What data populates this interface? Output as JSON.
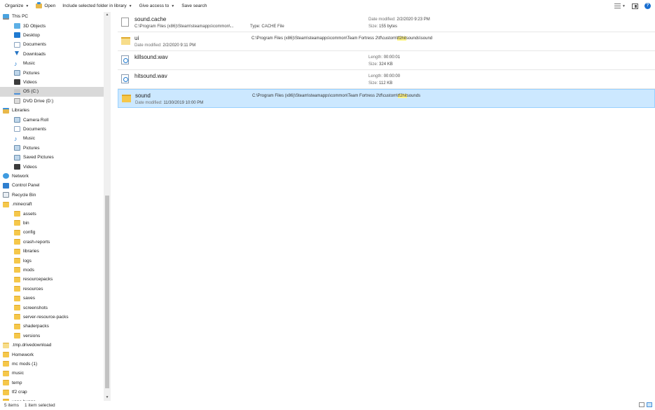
{
  "toolbar": {
    "organize": "Organize",
    "open": "Open",
    "include_library": "Include selected folder in library",
    "give_access": "Give access to",
    "save_search": "Save search"
  },
  "nav": {
    "items": [
      {
        "label": "This PC",
        "icon": "pc",
        "indent": 4
      },
      {
        "label": "3D Objects",
        "icon": "cube",
        "indent": 20
      },
      {
        "label": "Desktop",
        "icon": "desk",
        "indent": 20
      },
      {
        "label": "Documents",
        "icon": "doc",
        "indent": 20
      },
      {
        "label": "Downloads",
        "icon": "down",
        "indent": 20
      },
      {
        "label": "Music",
        "icon": "music",
        "indent": 20
      },
      {
        "label": "Pictures",
        "icon": "pic",
        "indent": 20
      },
      {
        "label": "Videos",
        "icon": "vid",
        "indent": 20
      },
      {
        "label": "OS (C:)",
        "icon": "drive",
        "indent": 20,
        "selected": true
      },
      {
        "label": "DVD Drive (D:)",
        "icon": "dvd",
        "indent": 20
      },
      {
        "label": "Libraries",
        "icon": "lib",
        "indent": 4
      },
      {
        "label": "Camera Roll",
        "icon": "pic",
        "indent": 20
      },
      {
        "label": "Documents",
        "icon": "doc",
        "indent": 20
      },
      {
        "label": "Music",
        "icon": "music",
        "indent": 20
      },
      {
        "label": "Pictures",
        "icon": "pic",
        "indent": 20
      },
      {
        "label": "Saved Pictures",
        "icon": "pic",
        "indent": 20
      },
      {
        "label": "Videos",
        "icon": "vid",
        "indent": 20
      },
      {
        "label": "Network",
        "icon": "net",
        "indent": 4
      },
      {
        "label": "Control Panel",
        "icon": "cp",
        "indent": 4
      },
      {
        "label": "Recycle Bin",
        "icon": "bin",
        "indent": 4
      },
      {
        "label": ".minecraft",
        "icon": "folder",
        "indent": 4
      },
      {
        "label": "assets",
        "icon": "folder",
        "indent": 20
      },
      {
        "label": "bin",
        "icon": "folder",
        "indent": 20
      },
      {
        "label": "config",
        "icon": "folder",
        "indent": 20
      },
      {
        "label": "crash-reports",
        "icon": "folder",
        "indent": 20
      },
      {
        "label": "libraries",
        "icon": "folder",
        "indent": 20
      },
      {
        "label": "logs",
        "icon": "folder",
        "indent": 20
      },
      {
        "label": "mods",
        "icon": "folder",
        "indent": 20
      },
      {
        "label": "resourcepacks",
        "icon": "folder",
        "indent": 20
      },
      {
        "label": "resources",
        "icon": "folder",
        "indent": 20
      },
      {
        "label": "saves",
        "icon": "folder",
        "indent": 20
      },
      {
        "label": "screenshots",
        "icon": "folder",
        "indent": 20
      },
      {
        "label": "server-resource-packs",
        "icon": "folder",
        "indent": 20
      },
      {
        "label": "shaderpacks",
        "icon": "folder",
        "indent": 20
      },
      {
        "label": "versions",
        "icon": "folder",
        "indent": 20
      },
      {
        "label": ".tmp.drivedownload",
        "icon": "folder light",
        "indent": 4
      },
      {
        "label": "Homework",
        "icon": "folder",
        "indent": 4
      },
      {
        "label": "mc mods (1)",
        "icon": "folder",
        "indent": 4
      },
      {
        "label": "music",
        "icon": "folder",
        "indent": 4
      },
      {
        "label": "temp",
        "icon": "folder",
        "indent": 4
      },
      {
        "label": "tf2 crap",
        "icon": "folder",
        "indent": 4
      },
      {
        "label": "vape bunge",
        "icon": "folder",
        "indent": 4
      }
    ]
  },
  "files": [
    {
      "name": "sound.cache",
      "icon": "file",
      "path_text": "C:\\Program Files (x86)\\Steam\\steamapps\\common\\...",
      "type_label": "Type:",
      "type_value": "CACHE File",
      "meta1_label": "Date modified:",
      "meta1_value": "2/2/2020 9:23 PM",
      "meta2_label": "Size:",
      "meta2_value": "155 bytes"
    },
    {
      "name": "ui",
      "icon": "folder open",
      "sub_label": "Date modified:",
      "sub_value": "2/2/2020 9:11 PM",
      "path_pre": "C:\\Program Files (x86)\\Steam\\steamapps\\common\\Team Fortress 2\\tf\\custom\\",
      "path_hl": "tf2hit",
      "path_post": "sounds\\sound"
    },
    {
      "name": "killsound.wav",
      "icon": "wav",
      "meta1_label": "Length:",
      "meta1_value": "00:00:01",
      "meta2_label": "Size:",
      "meta2_value": "324 KB"
    },
    {
      "name": "hitsound.wav",
      "icon": "wav",
      "meta1_label": "Length:",
      "meta1_value": "00:00:00",
      "meta2_label": "Size:",
      "meta2_value": "112 KB"
    },
    {
      "name": "sound",
      "icon": "folder",
      "selected": true,
      "sub_label": "Date modified:",
      "sub_value": "11/30/2019 10:00 PM",
      "path_pre": "C:\\Program Files (x86)\\Steam\\steamapps\\common\\Team Fortress 2\\tf\\custom\\",
      "path_hl": "tf2hit",
      "path_post": "sounds"
    }
  ],
  "status": {
    "items_count": "5 items",
    "selected_count": "1 item selected"
  }
}
